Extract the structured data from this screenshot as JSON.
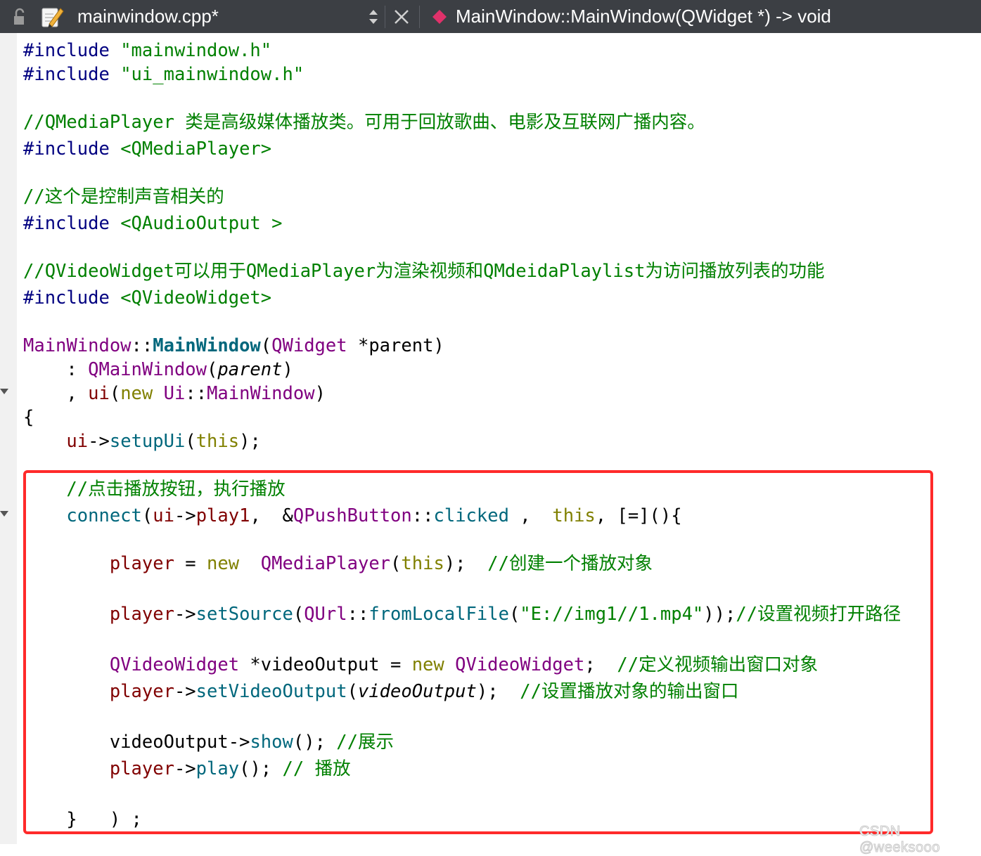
{
  "editor_bar": {
    "filename": "mainwindow.cpp*",
    "symbol": "MainWindow::MainWindow(QWidget *) -> void"
  },
  "code": {
    "l1": [
      "#include",
      " ",
      "\"mainwindow.h\""
    ],
    "l2": [
      "#include",
      " ",
      "\"ui_mainwindow.h\""
    ],
    "l4": "//QMediaPlayer 类是高级媒体播放类。可用于回放歌曲、电影及互联网广播内容。",
    "l5": [
      "#include",
      " ",
      "<QMediaPlayer>"
    ],
    "l7": "//这个是控制声音相关的",
    "l8": [
      "#include",
      " ",
      "<QAudioOutput >"
    ],
    "l10": "//QVideoWidget可以用于QMediaPlayer为渲染视频和QMdeidaPlaylist为访问播放列表的功能",
    "l11": [
      "#include",
      " ",
      "<QVideoWidget>"
    ],
    "l13": [
      "MainWindow",
      "::",
      "MainWindow",
      "(",
      "QWidget",
      " *parent)"
    ],
    "l14": [
      "    : ",
      "QMainWindow",
      "(",
      "parent",
      ")"
    ],
    "l15": [
      "    , ",
      "ui",
      "(",
      "new",
      " ",
      "Ui",
      "::",
      "MainWindow",
      ")"
    ],
    "l16": "{",
    "l17": [
      "    ",
      "ui",
      "->",
      "setupUi",
      "(",
      "this",
      ");"
    ],
    "l19": "    //点击播放按钮，执行播放",
    "l20": [
      "    ",
      "connect",
      "(",
      "ui",
      "->",
      "play1",
      ",  &",
      "QPushButton",
      "::",
      "clicked",
      " ,  ",
      "this",
      ", [=](){"
    ],
    "l22": [
      "        ",
      "player",
      " = ",
      "new",
      "  ",
      "QMediaPlayer",
      "(",
      "this",
      ");  ",
      "//创建一个播放对象"
    ],
    "l24": [
      "        ",
      "player",
      "->",
      "setSource",
      "(",
      "QUrl",
      "::",
      "fromLocalFile",
      "(",
      "\"E://img1//1.mp4\"",
      "));",
      "//设置视频打开路径"
    ],
    "l26": [
      "        ",
      "QVideoWidget",
      " *videoOutput = ",
      "new",
      " ",
      "QVideoWidget",
      ";  ",
      "//定义视频输出窗口对象"
    ],
    "l27": [
      "        ",
      "player",
      "->",
      "setVideoOutput",
      "(",
      "videoOutput",
      ");  ",
      "//设置播放对象的输出窗口"
    ],
    "l29": [
      "        ",
      "videoOutput",
      "->",
      "show",
      "(); ",
      "//展示"
    ],
    "l30": [
      "        ",
      "player",
      "->",
      "play",
      "(); ",
      "// 播放"
    ],
    "l32": [
      "    }   ) ;"
    ]
  },
  "watermark": "CSDN @weeksooo"
}
